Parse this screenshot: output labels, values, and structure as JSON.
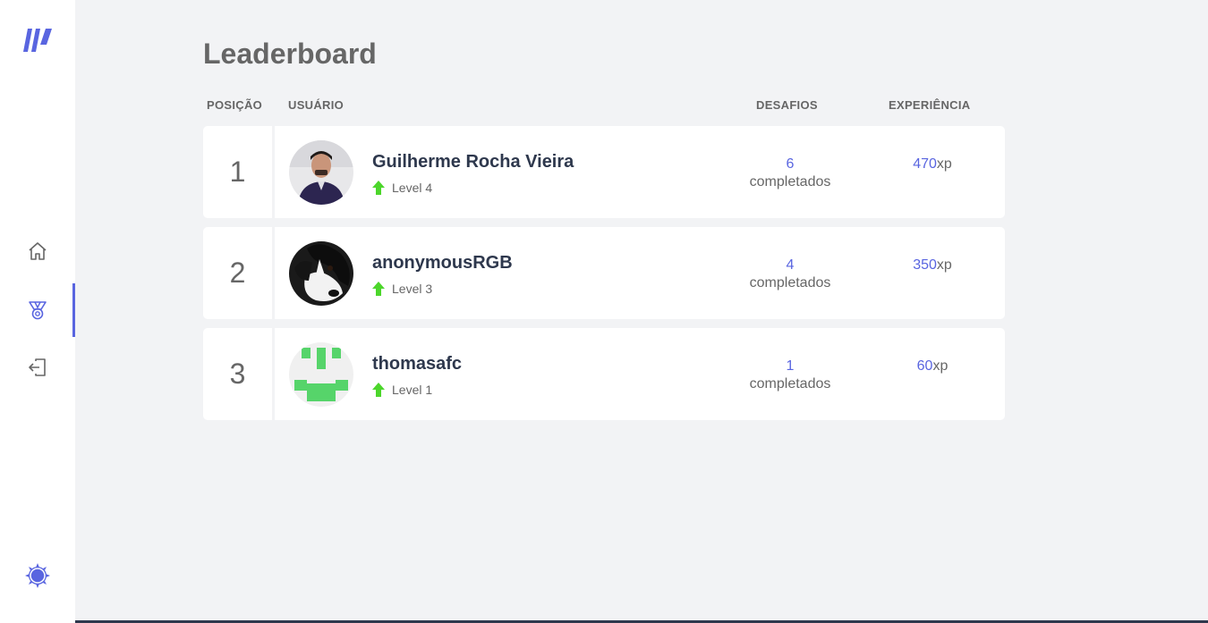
{
  "page": {
    "title": "Leaderboard"
  },
  "sidebar": {
    "logo": "moveit-logo",
    "items": [
      {
        "name": "home",
        "icon": "home-icon",
        "active": false
      },
      {
        "name": "leaderboard",
        "icon": "medal-icon",
        "active": true
      },
      {
        "name": "logout",
        "icon": "logout-icon",
        "active": false
      }
    ],
    "theme_icon": "theme-toggle-icon",
    "accent_color": "#5965e0"
  },
  "table": {
    "headers": {
      "position": "POSIÇÃO",
      "user": "USUÁRIO",
      "challenges": "DESAFIOS",
      "experience": "EXPERIÊNCIA"
    },
    "rows": [
      {
        "position": "1",
        "name": "Guilherme Rocha Vieira",
        "level": "Level 4",
        "challenges": "6",
        "challenges_suffix": "completados",
        "xp": "470",
        "xp_suffix": "xp",
        "avatar": "avatar-photo-man"
      },
      {
        "position": "2",
        "name": "anonymousRGB",
        "level": "Level 3",
        "challenges": "4",
        "challenges_suffix": "completados",
        "xp": "350",
        "xp_suffix": "xp",
        "avatar": "avatar-dog"
      },
      {
        "position": "3",
        "name": "thomasafc",
        "level": "Level 1",
        "challenges": "1",
        "challenges_suffix": "completados",
        "xp": "60",
        "xp_suffix": "xp",
        "avatar": "avatar-identicon"
      }
    ]
  },
  "colors": {
    "level_up": "#4cd62b",
    "text": "#666666",
    "title": "#2e384d"
  }
}
